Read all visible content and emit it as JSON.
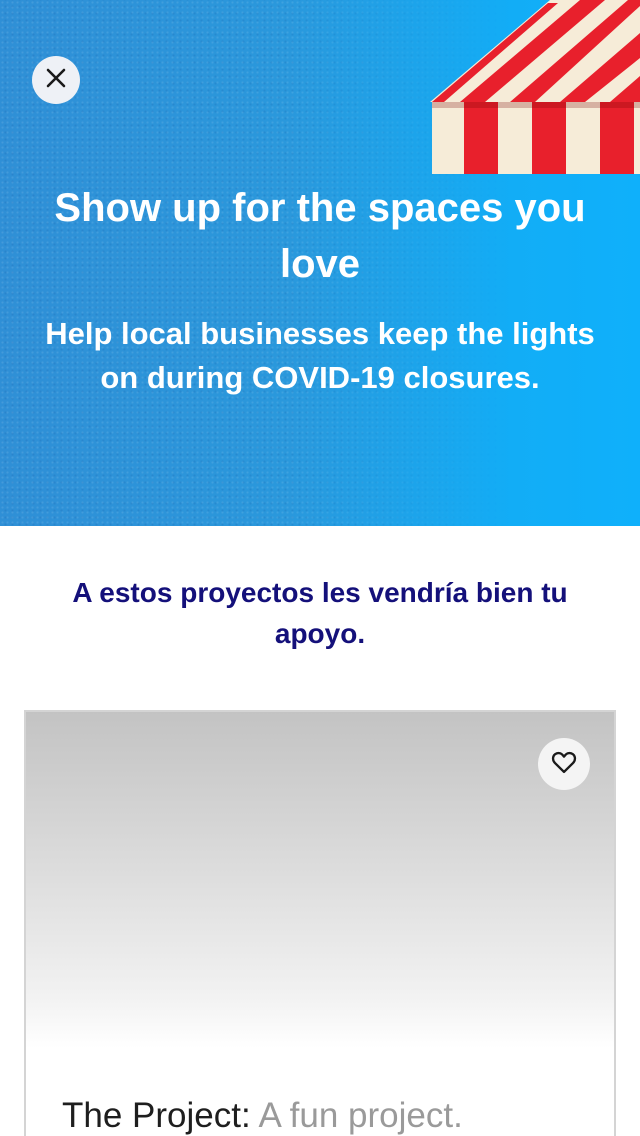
{
  "hero": {
    "title": "Show up for the spaces you love",
    "subtitle": "Help local businesses keep the lights on during COVID-19 closures.",
    "close_icon": "close-icon",
    "illustration": "striped-awning",
    "colors": {
      "background_start": "#2f8fd6",
      "background_end": "#0fb0fb",
      "awning_red": "#e8202c",
      "awning_cream": "#f7eedd"
    }
  },
  "section": {
    "heading": "A estos proyectos les vendría bien tu apoyo.",
    "heading_color": "#14107a"
  },
  "project_card": {
    "name": "The Project:",
    "description": "A fun project.",
    "favorite_icon": "heart-icon"
  }
}
